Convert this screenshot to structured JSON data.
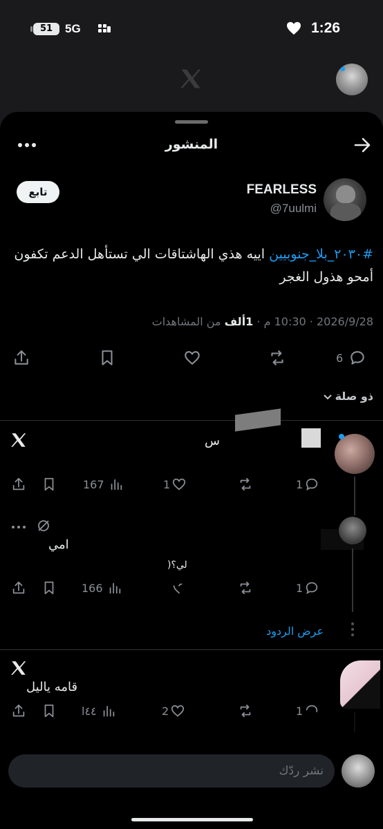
{
  "status_bar": {
    "battery": "51",
    "network": "5G",
    "time": "1:26"
  },
  "header": {
    "title": "المنشور"
  },
  "author": {
    "name": "FEARLESS",
    "handle": "@7uulmi",
    "follow_label": "تابع"
  },
  "tweet": {
    "hashtag": "#٢٠٣٠_بلا_جنوبيين",
    "text_rest": " اييه هذي الهاشتاقات الي تستأهل الدعم تكفون أمحو هذول الغجر",
    "date": "2026/9/28",
    "time": "10:30 م",
    "views_count": "1ألف",
    "views_label": "من المشاهدات",
    "replies_count": "6"
  },
  "sort_label": "ذو صلة",
  "replies": [
    {
      "fragment": "س",
      "replies": "1",
      "likes": "1",
      "views": "167"
    },
    {
      "fragment": "امي",
      "fragment2": "لي؟(",
      "replies": "1",
      "views": "166"
    },
    {
      "fragment": "قامه ياليل",
      "replies": "1",
      "likes": "2",
      "views": "٤٤ا"
    }
  ],
  "show_replies_label": "عرض الردود",
  "composer": {
    "placeholder": "نشر ردّك"
  }
}
